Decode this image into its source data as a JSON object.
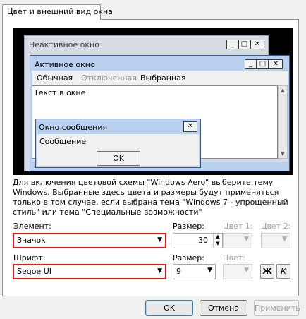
{
  "tab": {
    "label": "Цвет и внешний вид окна"
  },
  "preview": {
    "inactive_title": "Неактивное окно",
    "active_title": "Активное окно",
    "menu": {
      "normal": "Обычная",
      "disabled": "Отключенная",
      "selected": "Выбранная"
    },
    "window_text": "Текст в окне",
    "message_title": "Окно сообщения",
    "message_text": "Сообщение",
    "ok_label": "OK",
    "minimize_glyph": "_",
    "maximize_glyph": "□",
    "close_glyph": "✕"
  },
  "description": "Для включения цветовой схемы \"Windows Aero\" выберите тему Windows. Выбранные здесь цвета и размеры будут применяться только в том случае, если выбрана тема \"Windows 7 - упрощенный стиль\" или тема \"Специальные возможности\"",
  "element": {
    "label": "Элемент:",
    "value": "Значок",
    "size_label": "Размер:",
    "size_value": "30",
    "color1_label": "Цвет 1:",
    "color2_label": "Цвет 2:"
  },
  "font": {
    "label": "Шрифт:",
    "value": "Segoe UI",
    "size_label": "Размер:",
    "size_value": "9",
    "color_label": "Цвет:",
    "bold_label": "Ж",
    "italic_label": "К"
  },
  "footer": {
    "ok_label": "OK",
    "cancel_label": "Отмена",
    "apply_label": "Применить"
  }
}
